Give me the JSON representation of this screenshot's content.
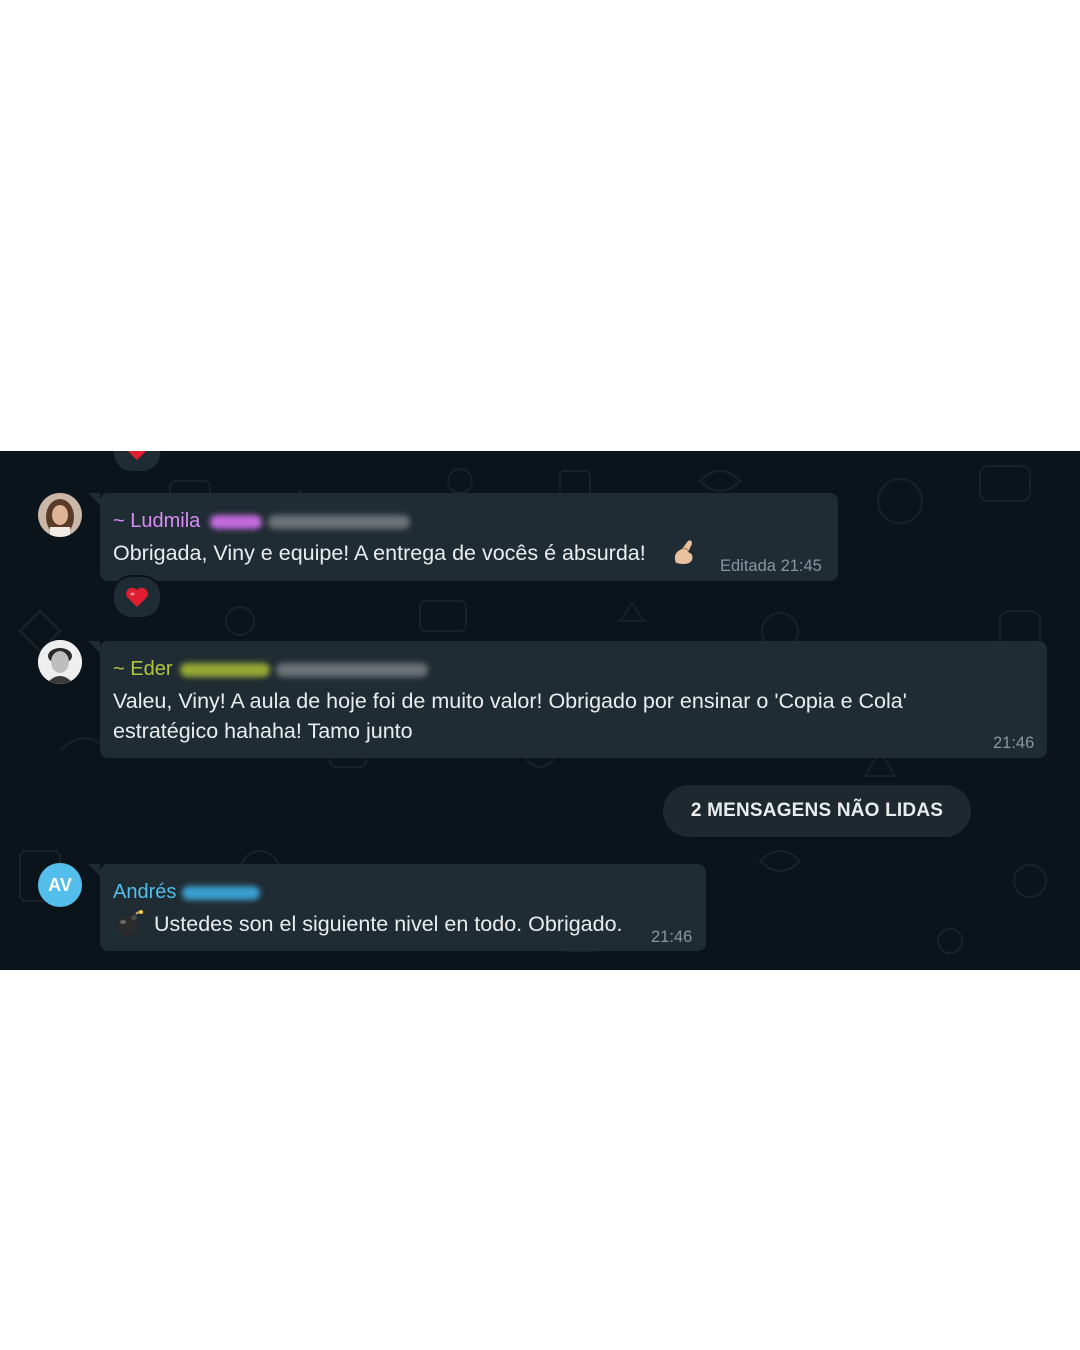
{
  "messages": [
    {
      "sender_name": "~ Ludmila",
      "sender_color": "#d98cf5",
      "text": "Obrigada, Viny e equipe! A entrega de vocês é absurda!",
      "edited_label": "Editada",
      "time": "21:45",
      "emoji_icon": "pinching-hand-icon",
      "reaction_icon": "heart-icon"
    },
    {
      "sender_name": "~ Eder",
      "sender_color": "#b4c53e",
      "text": "Valeu, Viny! A aula de hoje foi de muito valor! Obrigado por ensinar o 'Copia e Cola' estratégico hahaha! Tamo junto",
      "time": "21:46"
    },
    {
      "avatar_initials": "AV",
      "avatar_color": "#53bdeb",
      "sender_name": "Andrés",
      "sender_color": "#53bdeb",
      "emoji_icon": "bomb-icon",
      "text": "Ustedes son el siguiente nivel en todo. Obrigado.",
      "time": "21:46"
    }
  ],
  "unread_banner": "2 MENSAGENS NÃO LIDAS",
  "colors": {
    "chat_background": "#0b141a",
    "bubble": "#202c33",
    "text": "#e9edef",
    "meta_text": "#8696a0"
  }
}
